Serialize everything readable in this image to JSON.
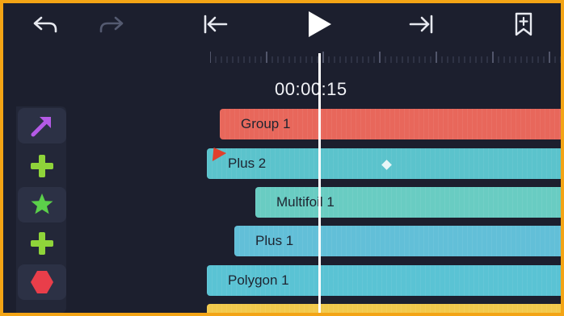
{
  "toolbar": {
    "undo": "undo-icon",
    "redo": "redo-icon",
    "go_start": "skip-to-start-icon",
    "play": "play-icon",
    "go_end": "skip-to-end-icon",
    "bookmark": "bookmark-add-icon"
  },
  "timeline": {
    "timecode": "00:00:15"
  },
  "layers": [
    {
      "label": "Group 1",
      "icon": "arrow-icon",
      "icon_color": "#b45ae6",
      "bar_color": "#e8675b"
    },
    {
      "label": "Plus 2",
      "icon": "plus-icon",
      "icon_color": "#8fd43a",
      "bar_color": "#5bc3cc"
    },
    {
      "label": "Multifoil 1",
      "icon": "star-icon",
      "icon_color": "#5bd04a",
      "bar_color": "#69ccc2"
    },
    {
      "label": "Plus 1",
      "icon": "plus-icon",
      "icon_color": "#8fd43a",
      "bar_color": "#62bfd8"
    },
    {
      "label": "Polygon 1",
      "icon": "hexagon-icon",
      "icon_color": "#e93e4a",
      "bar_color": "#5ac3d4"
    }
  ],
  "colors": {
    "frame": "#f3a415",
    "background": "#1c1f2e",
    "partial_bar": "#f2c94c"
  }
}
